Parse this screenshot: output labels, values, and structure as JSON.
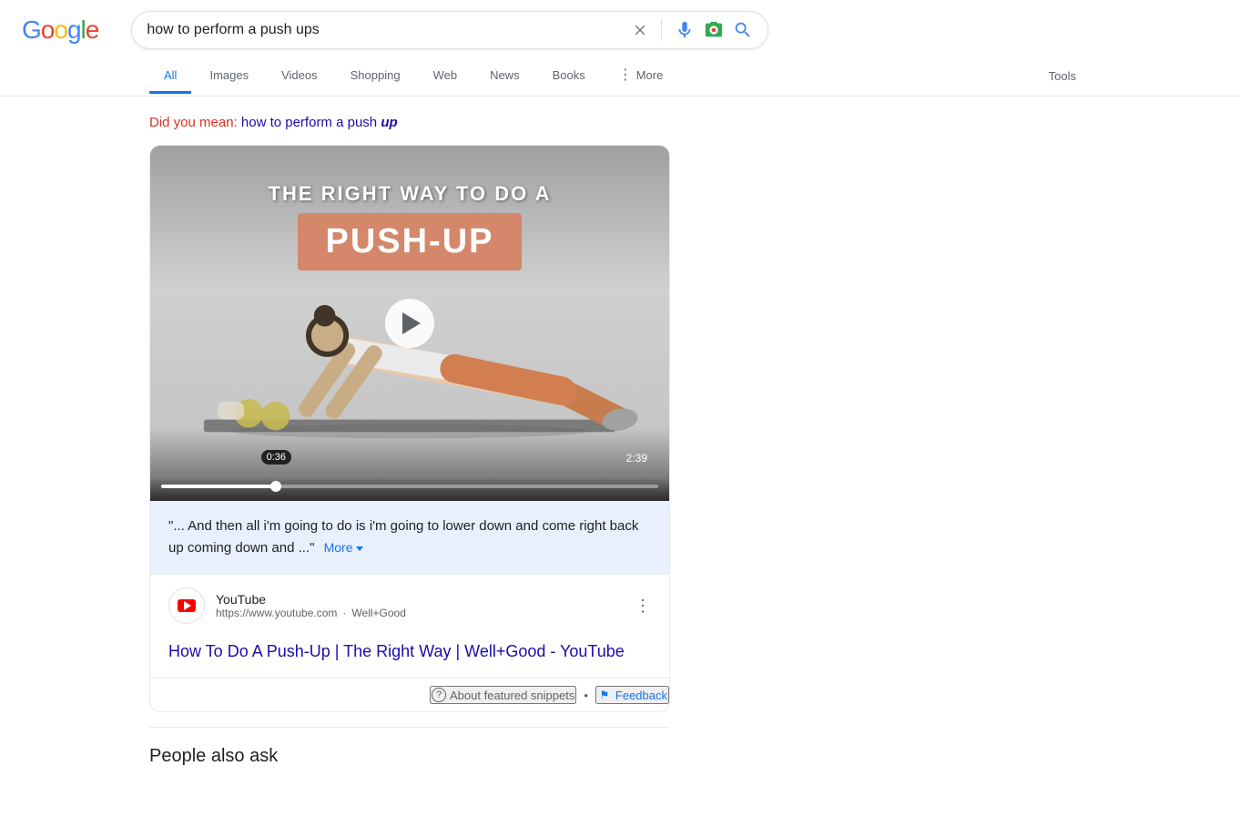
{
  "header": {
    "logo": "Google",
    "search_query": "how to perform a push ups",
    "clear_label": "×",
    "mic_label": "voice search",
    "camera_label": "search by image",
    "search_label": "search"
  },
  "nav": {
    "tabs": [
      {
        "id": "all",
        "label": "All",
        "active": true
      },
      {
        "id": "images",
        "label": "Images",
        "active": false
      },
      {
        "id": "videos",
        "label": "Videos",
        "active": false
      },
      {
        "id": "shopping",
        "label": "Shopping",
        "active": false
      },
      {
        "id": "web",
        "label": "Web",
        "active": false
      },
      {
        "id": "news",
        "label": "News",
        "active": false
      },
      {
        "id": "books",
        "label": "Books",
        "active": false
      },
      {
        "id": "more",
        "label": "More",
        "active": false
      }
    ],
    "tools_label": "Tools"
  },
  "did_you_mean": {
    "label": "Did you mean:",
    "link_text": "how to perform a push",
    "link_bold": "up"
  },
  "featured_snippet": {
    "video": {
      "title_top": "THE RIGHT WAY TO DO A",
      "title_banner": "PUSH-UP",
      "time_current": "0:36",
      "time_total": "2:39"
    },
    "snippet_text": "\"... And then all i'm going to do is i'm going to lower down and come right back up coming down and ...\"",
    "more_label": "More",
    "source": {
      "name": "YouTube",
      "url": "https://www.youtube.com",
      "channel": "Well+Good",
      "menu_dots": "⋮"
    },
    "result_link": "How To Do A Push-Up | The Right Way | Well+Good - YouTube"
  },
  "about_section": {
    "about_label": "About featured snippets",
    "dot": "•",
    "feedback_icon_label": "feedback-icon",
    "feedback_label": "Feedback"
  },
  "bottom": {
    "partial_text": "People also ask"
  }
}
